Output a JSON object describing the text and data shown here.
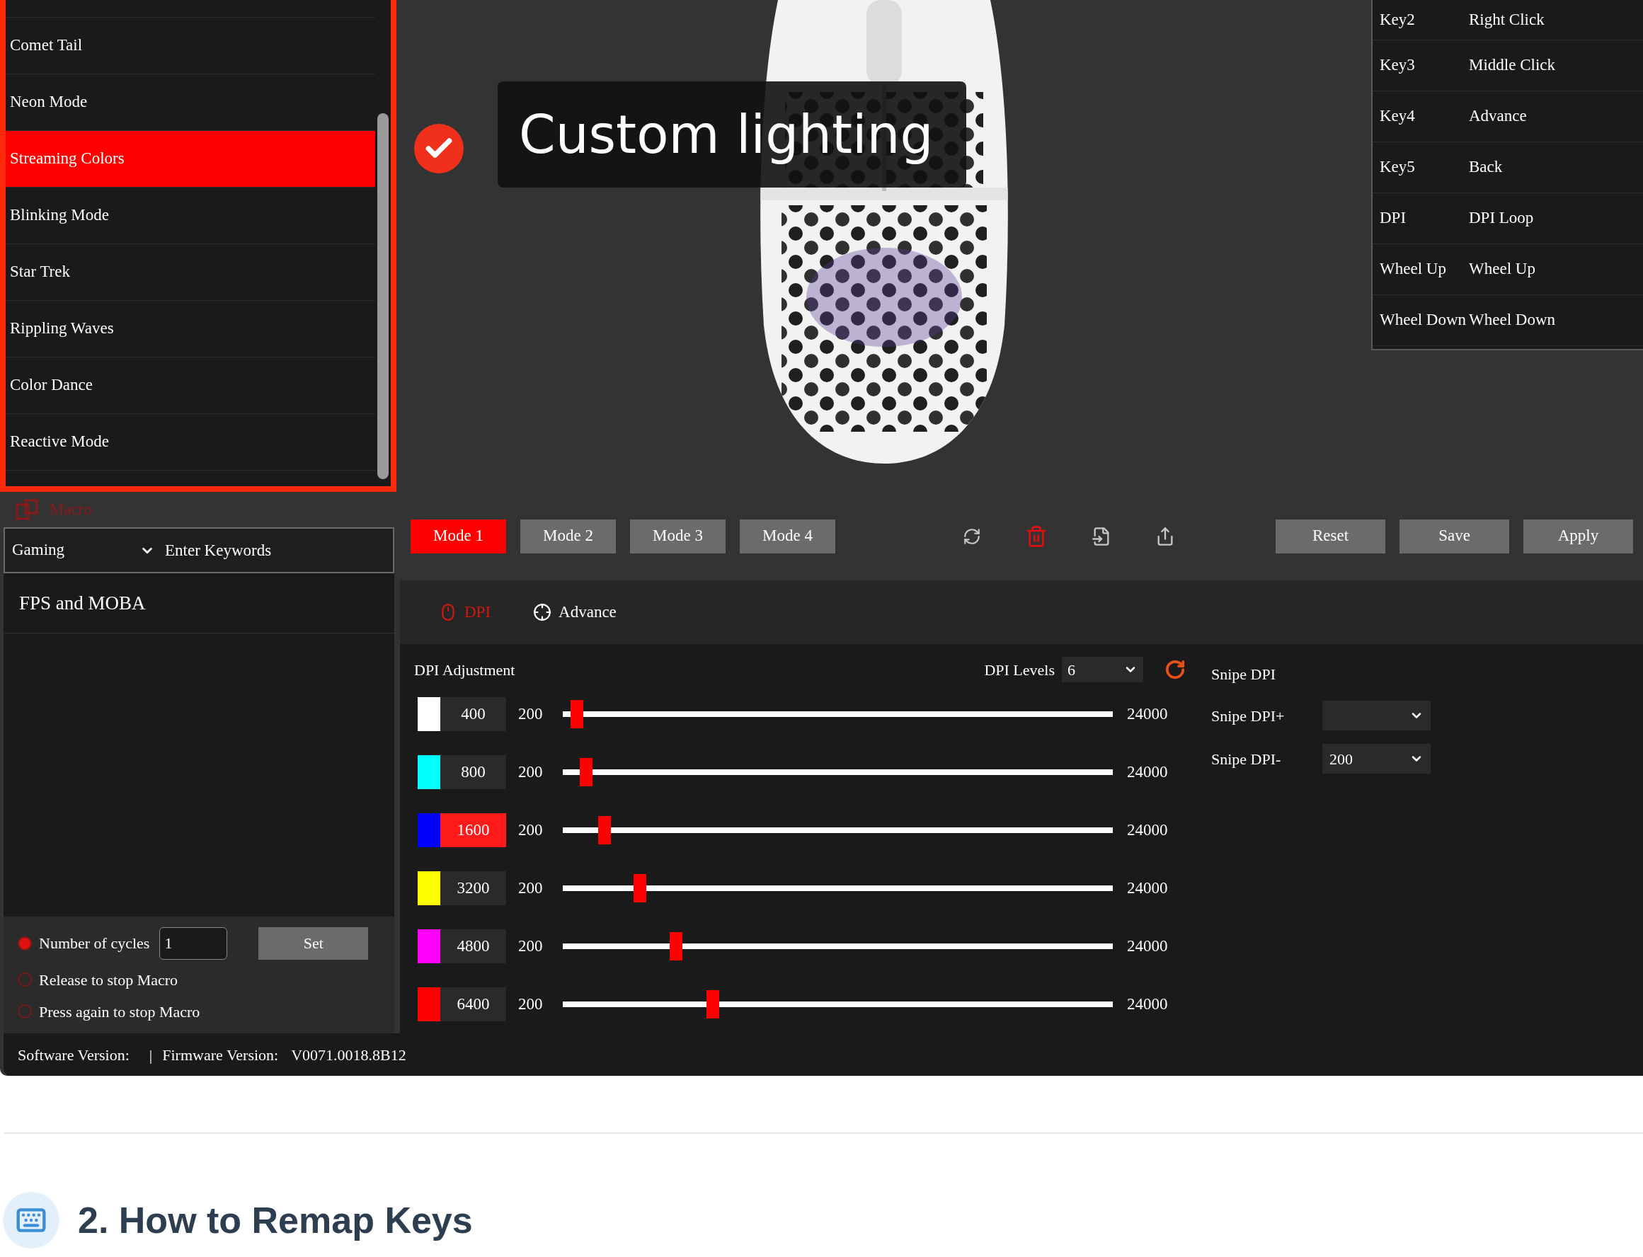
{
  "lighting_modes": [
    {
      "label": "Comet Tail",
      "selected": false
    },
    {
      "label": "Neon Mode",
      "selected": false
    },
    {
      "label": "Streaming Colors",
      "selected": true
    },
    {
      "label": "Blinking Mode",
      "selected": false
    },
    {
      "label": "Star Trek",
      "selected": false
    },
    {
      "label": "Rippling Waves",
      "selected": false
    },
    {
      "label": "Color Dance",
      "selected": false
    },
    {
      "label": "Reactive Mode",
      "selected": false
    }
  ],
  "tooltip": {
    "text": "Custom lighting"
  },
  "key_bindings": [
    {
      "key": "Key2",
      "action": "Right Click"
    },
    {
      "key": "Key3",
      "action": "Middle Click"
    },
    {
      "key": "Key4",
      "action": "Advance"
    },
    {
      "key": "Key5",
      "action": "Back"
    },
    {
      "key": "DPI",
      "action": "DPI Loop"
    },
    {
      "key": "Wheel Up",
      "action": "Wheel Up"
    },
    {
      "key": "Wheel Down",
      "action": "Wheel Down"
    }
  ],
  "macro_label": "Macro",
  "macro_panel": {
    "category": "Gaming",
    "search_placeholder": "Enter Keywords",
    "items": [
      "FPS and MOBA"
    ],
    "set_button": "Set",
    "options": [
      {
        "kind": "cycles",
        "label": "Number of cycles",
        "value": "1",
        "selected": true
      },
      {
        "kind": "plain",
        "label": "Release to stop Macro",
        "selected": false
      },
      {
        "kind": "plain",
        "label": "Press again to stop Macro",
        "selected": false
      }
    ]
  },
  "modes": [
    {
      "label": "Mode 1",
      "selected": true
    },
    {
      "label": "Mode 2",
      "selected": false
    },
    {
      "label": "Mode 3",
      "selected": false
    },
    {
      "label": "Mode 4",
      "selected": false
    }
  ],
  "actions": [
    "Reset",
    "Save",
    "Apply"
  ],
  "tabs": [
    {
      "label": "DPI",
      "kind": "dpi",
      "selected": true
    },
    {
      "label": "Advance",
      "kind": "advance",
      "selected": false
    }
  ],
  "dpi": {
    "title": "DPI Adjustment",
    "levels_label": "DPI Levels",
    "levels_value": "6",
    "rows": [
      {
        "value": "400",
        "color": "#ffffff",
        "selected": false,
        "min": "200",
        "max": "24000",
        "level": 0.019
      },
      {
        "value": "800",
        "color": "#00ffff",
        "selected": false,
        "min": "200",
        "max": "24000",
        "level": 0.036
      },
      {
        "value": "1600",
        "color": "#0000ff",
        "selected": true,
        "min": "200",
        "max": "24000",
        "level": 0.069
      },
      {
        "value": "3200",
        "color": "#ffff00",
        "selected": false,
        "min": "200",
        "max": "24000",
        "level": 0.134
      },
      {
        "value": "4800",
        "color": "#ff00ff",
        "selected": false,
        "min": "200",
        "max": "24000",
        "level": 0.2
      },
      {
        "value": "6400",
        "color": "#ff0000",
        "selected": false,
        "min": "200",
        "max": "24000",
        "level": 0.267
      }
    ]
  },
  "snipe": {
    "title": "Snipe DPI",
    "plus_label": "Snipe DPI+",
    "minus_label": "Snipe DPI-",
    "minus_value": "200"
  },
  "status_bar": {
    "software_label": "Software Version:",
    "separator": "|",
    "firmware_label": "Firmware Version:",
    "firmware_value": "V0071.0018.8B12"
  },
  "heading": "2. How to Remap Keys"
}
